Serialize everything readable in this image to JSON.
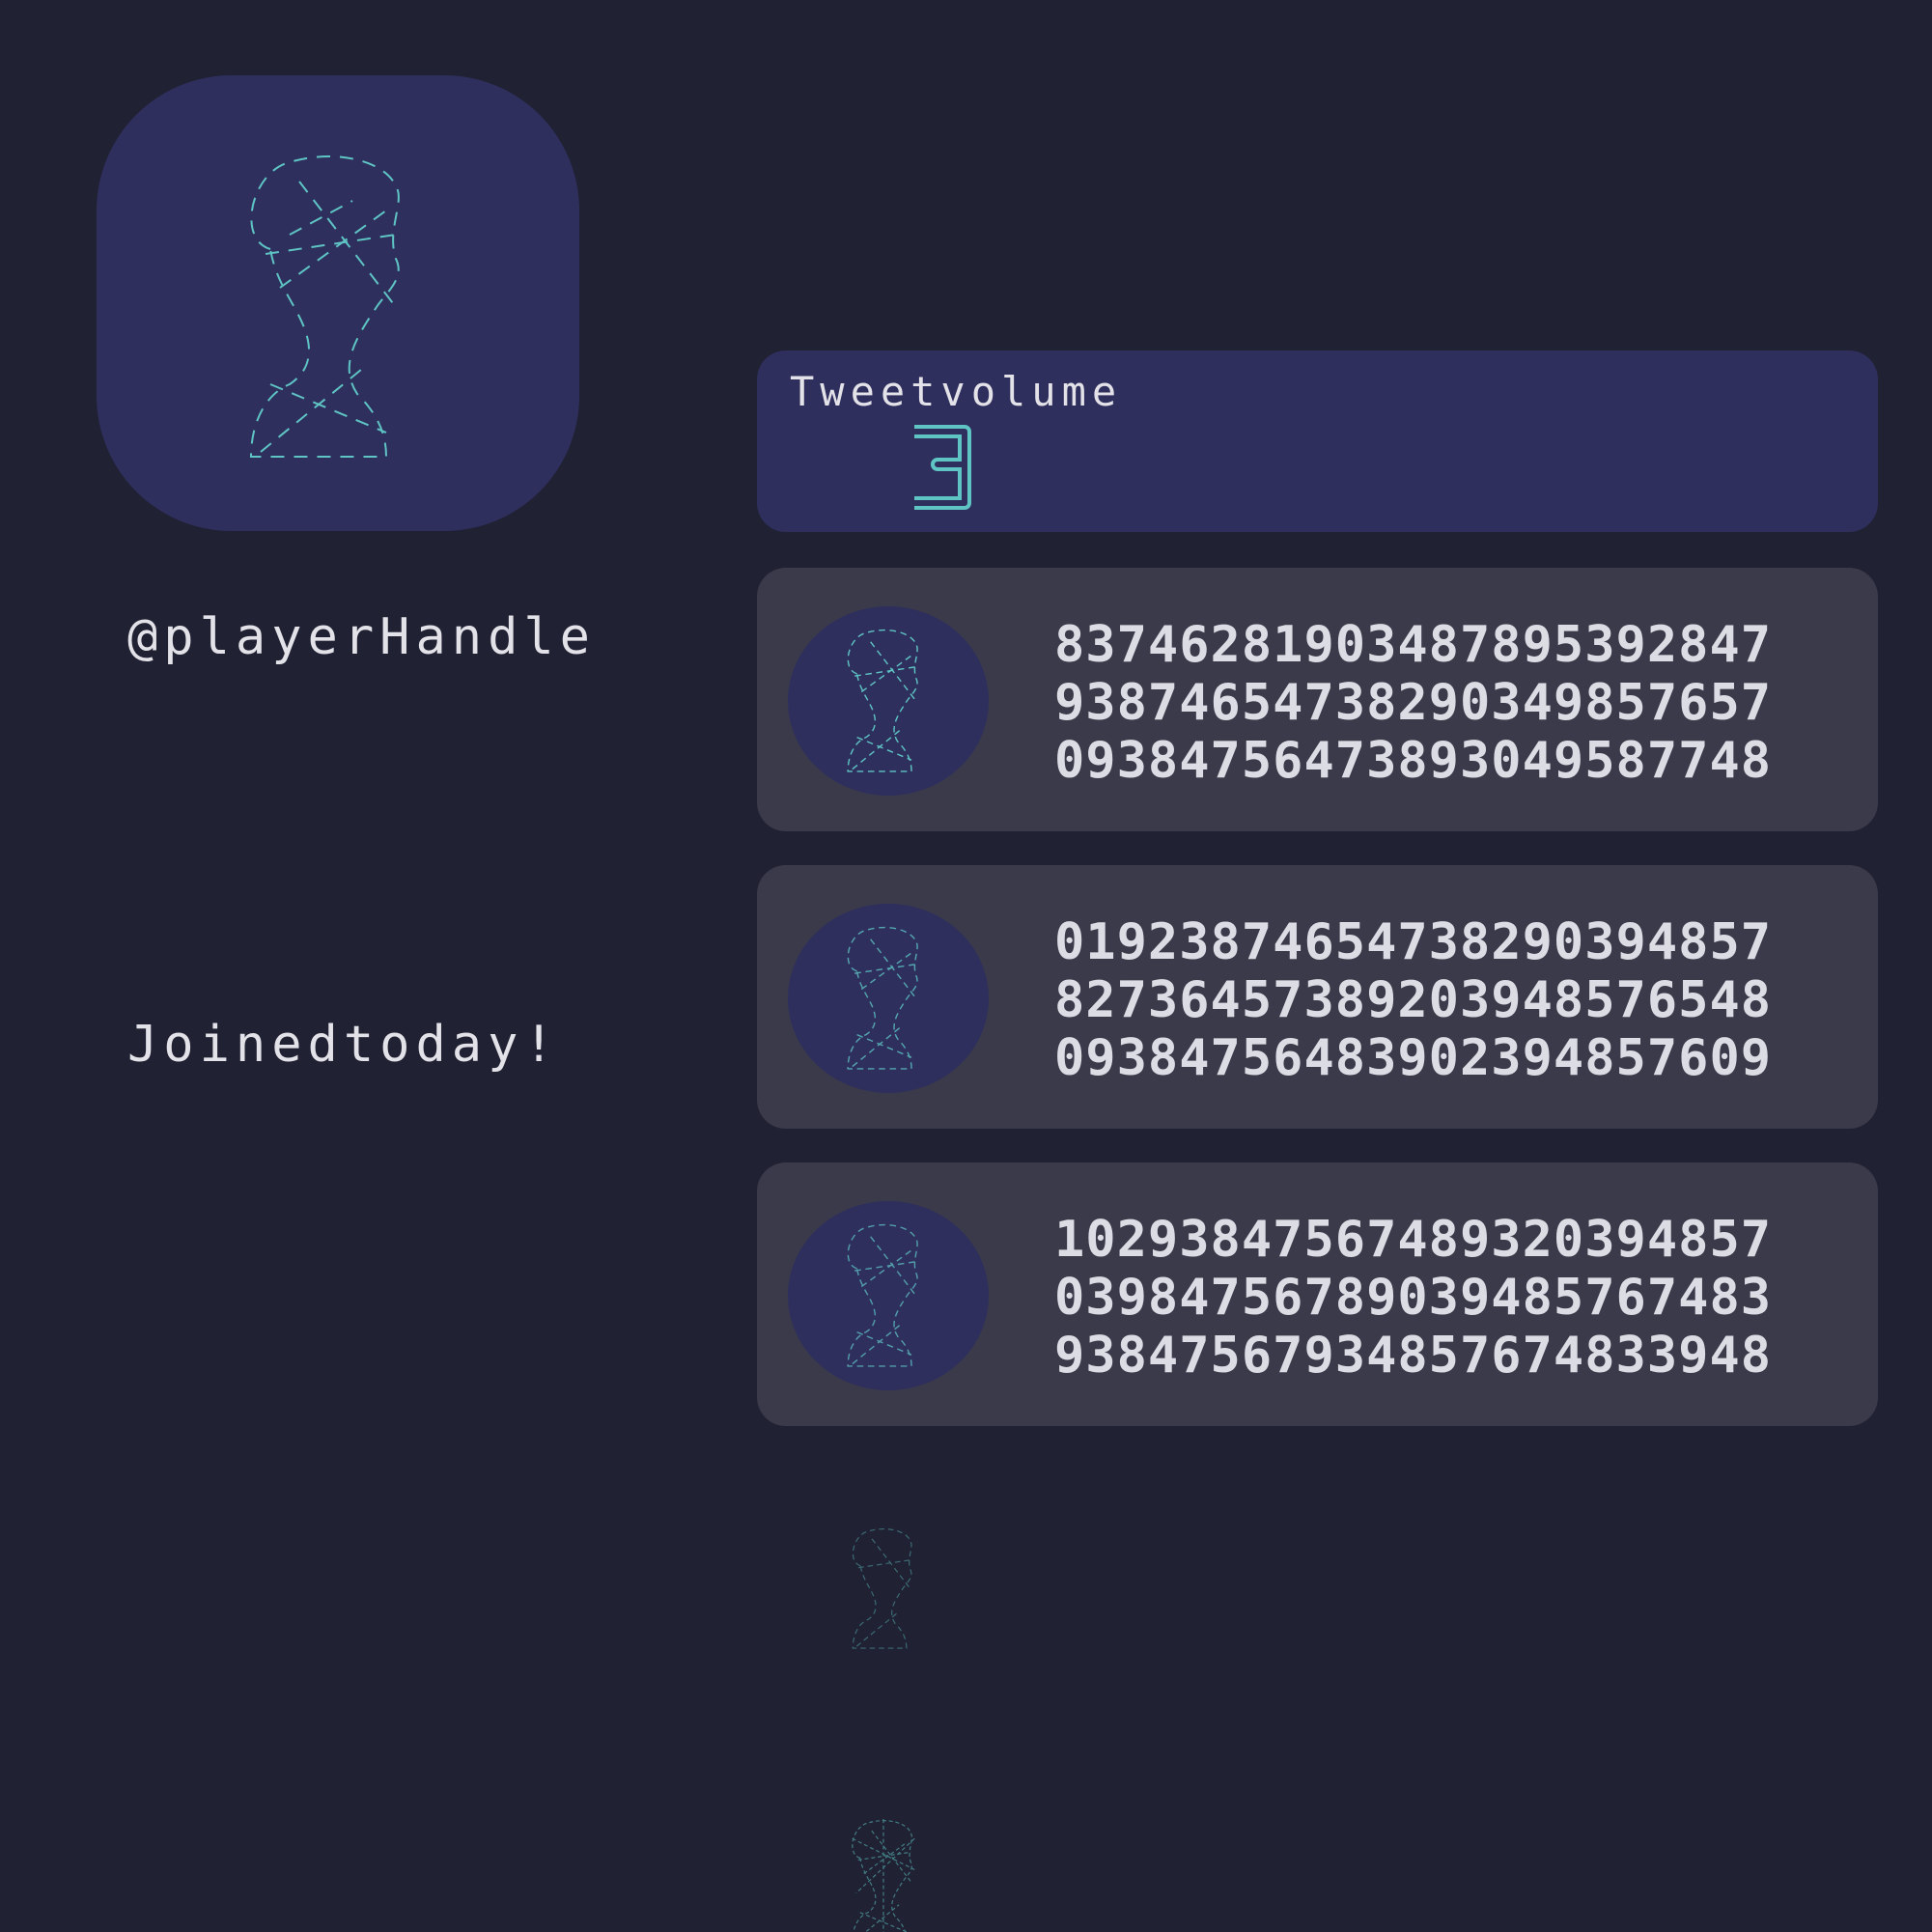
{
  "profile": {
    "avatar_icon": "dashed-person-silhouette-icon",
    "handle": "@playerHandle",
    "joined": "Joined today!"
  },
  "stats": {
    "volume_label": "Tweet volume",
    "volume_value": "3"
  },
  "tweets": [
    {
      "lines": [
        "8374628190348789539284​7",
        "938746547382903498576 57",
        "093847564738930495877 48"
      ]
    },
    {
      "lines": [
        "019238746547382903948 57",
        "827364573892039485765 48",
        "093847564839023948576 09"
      ]
    },
    {
      "lines": [
        "102938475674893203948 57",
        "039847567890394857674 83",
        "938475679348576748339 48"
      ]
    }
  ],
  "colors": {
    "background": "#202133",
    "accent_panel": "#2f2f5e",
    "tweet_panel": "#3a3a4a",
    "teal": "#5ec4c4"
  }
}
